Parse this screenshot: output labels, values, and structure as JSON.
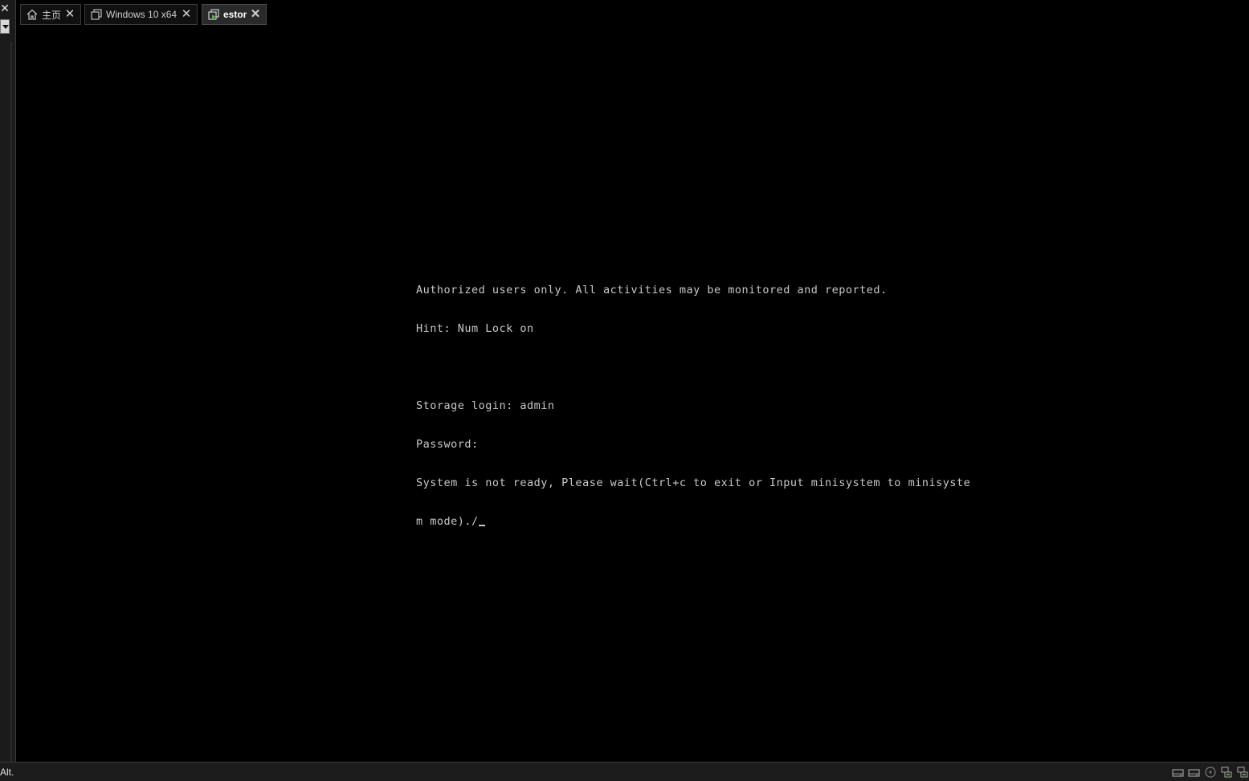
{
  "sidebar": {
    "close_glyph": "✕",
    "dropdown_icon": "chevron-down-icon"
  },
  "tabs": [
    {
      "label": "主页",
      "icon": "home-icon",
      "active": false,
      "close_glyph": "✕"
    },
    {
      "label": "Windows 10 x64",
      "icon": "vm-icon",
      "active": false,
      "close_glyph": "✕"
    },
    {
      "label": "estor",
      "icon": "vm-running-icon",
      "active": true,
      "close_glyph": "✕"
    }
  ],
  "console": {
    "lines": [
      "Authorized users only. All activities may be monitored and reported.",
      "Hint: Num Lock on",
      "",
      "Storage login: admin",
      "Password:",
      "System is not ready, Please wait(Ctrl+c to exit or Input minisystem to minisyste",
      "m mode)./"
    ],
    "text_color": "#c8c8c8",
    "background": "#000000"
  },
  "status_bar": {
    "text": "Alt.",
    "icons": [
      "hard-disk-icon",
      "hard-disk-icon",
      "cd-rom-icon",
      "network-icon",
      "network-icon"
    ]
  },
  "colors": {
    "accent_green": "#4caf50",
    "tab_active_bg": "#2a2a2a",
    "chrome_bg": "#1c1c1c"
  }
}
